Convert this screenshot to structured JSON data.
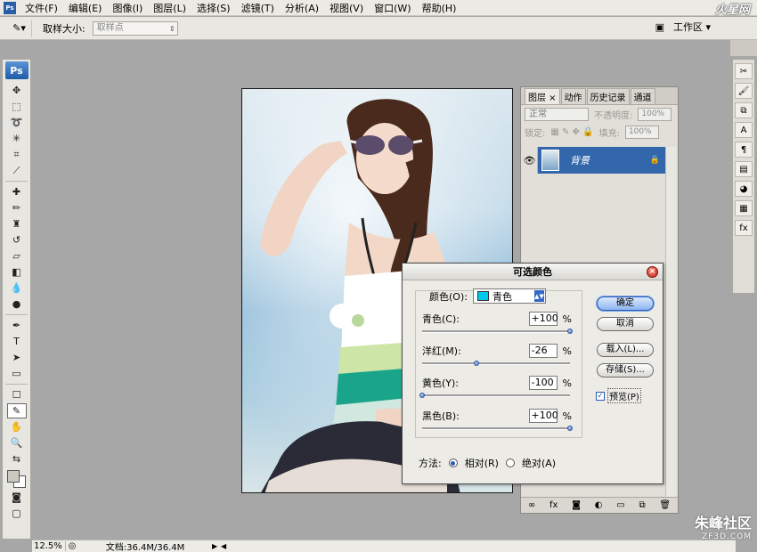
{
  "app": {
    "ps_badge": "Ps"
  },
  "menu": [
    "文件(F)",
    "编辑(E)",
    "图像(I)",
    "图层(L)",
    "选择(S)",
    "滤镜(T)",
    "分析(A)",
    "视图(V)",
    "窗口(W)",
    "帮助(H)"
  ],
  "options": {
    "sample_size_label": "取样大小:",
    "sample_size_value": "取样点",
    "workspace": "工作区 ▾"
  },
  "status": {
    "zoom": "12.5%",
    "doc_info": "文档:36.4M/36.4M"
  },
  "layers_panel": {
    "tabs": [
      "图层 ×",
      "动作",
      "历史记录",
      "通道"
    ],
    "blend_mode": "正常",
    "opacity_label": "不透明度:",
    "opacity_value": "100%",
    "lock_label": "锁定:",
    "fill_label": "填充:",
    "fill_value": "100%",
    "layer_name": "背景"
  },
  "dialog": {
    "title": "可选颜色",
    "color_label": "颜色(O):",
    "color_value": "青色",
    "sliders": [
      {
        "label": "青色(C):",
        "value": "+100",
        "unit": "%",
        "level": 100
      },
      {
        "label": "洋红(M):",
        "value": "-26",
        "unit": "%",
        "level": -26
      },
      {
        "label": "黄色(Y):",
        "value": "-100",
        "unit": "%",
        "level": -100
      },
      {
        "label": "黑色(B):",
        "value": "+100",
        "unit": "%",
        "level": 100
      }
    ],
    "method_label": "方法:",
    "method_relative": "相对(R)",
    "method_absolute": "绝对(A)",
    "buttons": {
      "ok": "确定",
      "cancel": "取消",
      "load": "载入(L)...",
      "save": "存储(S)..."
    },
    "preview": "预览(P)",
    "preview_checked": true
  },
  "watermark": {
    "name": "朱峰社区",
    "url": "ZF3D.COM"
  },
  "colors": {
    "accent": "#3366aa",
    "cyan_chip": "#00c8e8",
    "bg": "#a7a7a7"
  }
}
